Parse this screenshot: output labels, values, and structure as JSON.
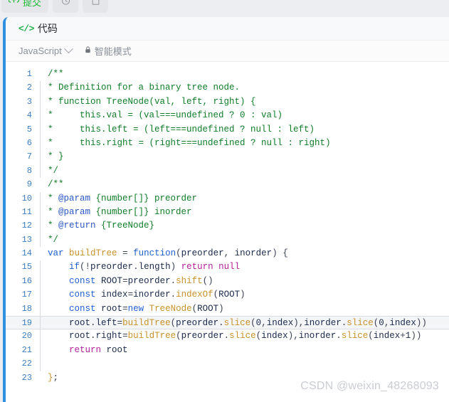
{
  "toolbar": {
    "submit": {
      "label": "提交",
      "icon": "upload-cloud-icon"
    },
    "history": {
      "icon": "history-clock-icon"
    },
    "note": {
      "icon": "note-page-icon"
    }
  },
  "panel": {
    "code_tag": "</>",
    "title": "代码",
    "language": "JavaScript",
    "mode_label": "智能模式",
    "lock_icon": "lock-icon",
    "chevron_icon": "chevron-down-icon"
  },
  "editor": {
    "active_line": 19,
    "lines": [
      {
        "n": "1",
        "indent": false,
        "html": "<span class='cm'>/**</span>"
      },
      {
        "n": "2",
        "indent": true,
        "html": "<span class='cm'>* Definition for a binary tree node.</span>"
      },
      {
        "n": "3",
        "indent": true,
        "html": "<span class='cm'>* function TreeNode(val, left, right) {</span>"
      },
      {
        "n": "4",
        "indent": true,
        "html": "<span class='cm'>*     this.val = (val===undefined ? 0 : val)</span>"
      },
      {
        "n": "5",
        "indent": true,
        "html": "<span class='cm'>*     this.left = (left===undefined ? null : left)</span>"
      },
      {
        "n": "6",
        "indent": true,
        "html": "<span class='cm'>*     this.right = (right===undefined ? null : right)</span>"
      },
      {
        "n": "7",
        "indent": true,
        "html": "<span class='cm'>* }</span>"
      },
      {
        "n": "8",
        "indent": true,
        "html": "<span class='cm'>*/</span>"
      },
      {
        "n": "9",
        "indent": false,
        "html": "<span class='cm'>/**</span>"
      },
      {
        "n": "10",
        "indent": true,
        "html": "<span class='cm'>* </span><span class='tag'>@param</span><span class='cm'> {number[]} preorder</span>"
      },
      {
        "n": "11",
        "indent": true,
        "html": "<span class='cm'>* </span><span class='tag'>@param</span><span class='cm'> {number[]} inorder</span>"
      },
      {
        "n": "12",
        "indent": true,
        "html": "<span class='cm'>* </span><span class='tag'>@return</span><span class='cm'> {TreeNode}</span>"
      },
      {
        "n": "13",
        "indent": true,
        "html": "<span class='cm'>*/</span>"
      },
      {
        "n": "14",
        "indent": false,
        "html": "<span class='kw'>var</span> <span class='fn'>buildTree</span> <span class='pn'>=</span> <span class='kw'>function</span><span class='pn'>(</span><span class='id'>preorder</span><span class='pn'>,</span> <span class='id'>inorder</span><span class='pn'>) {</span>"
      },
      {
        "n": "15",
        "indent": true,
        "html": "    <span class='kw'>if</span><span class='pn'>(!</span><span class='id'>preorder</span><span class='pn'>.</span><span class='id'>length</span><span class='pn'>)</span> <span class='kw2'>return</span> <span class='kw2'>null</span>"
      },
      {
        "n": "16",
        "indent": true,
        "html": "    <span class='kw'>const</span> <span class='id'>ROOT</span><span class='pn'>=</span><span class='id'>preorder</span><span class='pn'>.</span><span class='fn'>shift</span><span class='pn'>()</span>"
      },
      {
        "n": "17",
        "indent": true,
        "html": "    <span class='kw'>const</span> <span class='id'>index</span><span class='pn'>=</span><span class='id'>inorder</span><span class='pn'>.</span><span class='fn'>indexOf</span><span class='pn'>(</span><span class='id'>ROOT</span><span class='pn'>)</span>"
      },
      {
        "n": "18",
        "indent": true,
        "html": "    <span class='kw'>const</span> <span class='id'>root</span><span class='pn'>=</span><span class='kw'>new</span> <span class='fn'>TreeNode</span><span class='pn'>(</span><span class='id'>ROOT</span><span class='pn'>)</span>"
      },
      {
        "n": "19",
        "indent": true,
        "html": "    <span class='id'>root</span><span class='pn'>.</span><span class='id'>left</span><span class='pn'>=</span><span class='fn'>buildTree</span><span class='pn'>(</span><span class='id'>preorder</span><span class='pn'>.</span><span class='fn'>slice</span><span class='pn'>(</span><span class='num'>0</span><span class='pn'>,</span><span class='id'>index</span><span class='pn'>),</span><span class='id'>inorder</span><span class='pn'>.</span><span class='fn'>slice</span><span class='pn'>(</span><span class='num'>0</span><span class='pn'>,</span><span class='id'>index</span><span class='pn'>))</span>"
      },
      {
        "n": "20",
        "indent": true,
        "html": "    <span class='id'>root</span><span class='pn'>.</span><span class='id'>right</span><span class='pn'>=</span><span class='fn'>buildTree</span><span class='pn'>(</span><span class='id'>preorder</span><span class='pn'>.</span><span class='fn'>slice</span><span class='pn'>(</span><span class='id'>index</span><span class='pn'>),</span><span class='id'>inorder</span><span class='pn'>.</span><span class='fn'>slice</span><span class='pn'>(</span><span class='id'>index</span><span class='pn'>+</span><span class='num'>1</span><span class='pn'>))</span>"
      },
      {
        "n": "21",
        "indent": true,
        "html": "    <span class='kw2'>return</span> <span class='id'>root</span>"
      },
      {
        "n": "22",
        "indent": true,
        "html": ""
      },
      {
        "n": "23",
        "indent": false,
        "html": "<span class='fn'>}</span><span class='pn'>;</span>"
      }
    ]
  },
  "watermark": {
    "text": "CSDN @weixin_48268093"
  },
  "colors": {
    "accent_blue": "#2f8fe0",
    "submit_green": "#1cb832",
    "code_tag_green": "#22b14c",
    "comment_green": "#0f7d28",
    "keyword_blue": "#1f5fd0",
    "return_magenta": "#b4219b",
    "function_gold": "#c8922a",
    "gutter_blue": "#3c7ebf",
    "watermark_gray": "#c9ccd1"
  }
}
